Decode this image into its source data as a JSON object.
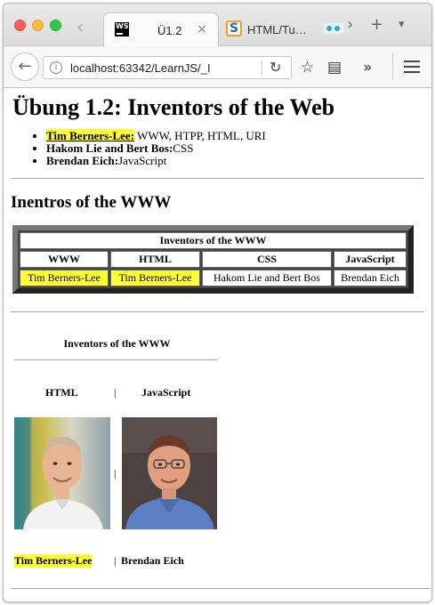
{
  "browser": {
    "tabs": [
      {
        "title": "Ü1.2",
        "icon": "webstorm-icon",
        "active": true
      },
      {
        "title": "HTML/Tu…",
        "icon": "selfhtml-icon",
        "active": false
      },
      {
        "title": "",
        "icon": "flickr-icon",
        "active": false
      }
    ],
    "close_glyph": "×",
    "url": "localhost:63342/LearnJS/_I",
    "glyphs": {
      "back": "←",
      "tab_back": "‹",
      "tab_forward": "›",
      "new_tab": "+",
      "tab_menu": "▾",
      "reload": "↻",
      "bookmark": "☆",
      "reader": "▤",
      "overflow": "»",
      "info": "i"
    }
  },
  "page": {
    "title": "Übung 1.2: Inventors of the Web",
    "list": [
      {
        "name": "Tim Berners-Lee:",
        "text": " WWW, HTPP, HTML, URI",
        "highlight": true
      },
      {
        "name": "Hakom Lie and Bert Bos:",
        "text": "CSS",
        "highlight": false
      },
      {
        "name": "Brendan Eich:",
        "text": "JavaScript",
        "highlight": false
      }
    ],
    "section_title": "Inentros of the WWW",
    "table": {
      "caption": "Inventors of the WWW",
      "headers": [
        "WWW",
        "HTML",
        "CSS",
        "JavaScript"
      ],
      "row": [
        "Tim Berners-Lee",
        "Tim Berners-Lee",
        "Hakom Lie and Bert Bos",
        "Brendan Eich"
      ],
      "highlight_color": "#ffff33"
    },
    "pictures": {
      "title": "Inventors of the WWW",
      "col1_head": "HTML",
      "col2_head": "JavaScript",
      "separator": "|",
      "name1": "Tim Berners-Lee",
      "name2": "Brendan Eich",
      "name_separator": "|"
    }
  }
}
